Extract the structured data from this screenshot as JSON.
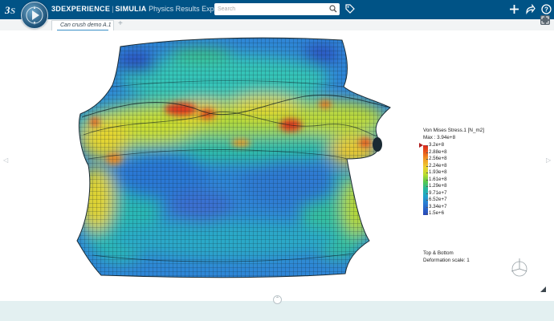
{
  "app": {
    "brand_3d": "3D",
    "brand_experience": "EXPERIENCE",
    "brand_simulia": "SIMULIA",
    "app_name": "Physics Results Explorer",
    "logo_icon": "3ds-logo-icon",
    "compass_icon": "compass-icon"
  },
  "search": {
    "placeholder": "Search",
    "value": ""
  },
  "tabs": [
    {
      "label": "Can crush demo A.1",
      "active": true
    }
  ],
  "tab_add": "+",
  "legend": {
    "title": "Von Mises Stress.1 [N_m2]",
    "max": "Max : 3.94e+8",
    "ticks": [
      "3.2e+8",
      "2.88e+8",
      "2.56e+8",
      "2.24e+8",
      "1.93e+8",
      "1.61e+8",
      "1.29e+8",
      "9.71e+7",
      "6.52e+7",
      "3.34e+7",
      "1.5e+6"
    ],
    "view": "Top & Bottom",
    "deformation": "Deformation scale: 1"
  },
  "colors": {
    "topbar": "#005386",
    "accent": "#3a8fc6",
    "bottom_panel": "#e3f0f1",
    "mesh_blue": "#2a6fd0",
    "mesh_teal": "#22b3b0",
    "mesh_yellow": "#e6d235",
    "mesh_red": "#d8281e"
  },
  "icons": [
    "search-icon",
    "tag-icon",
    "add-icon",
    "share-icon",
    "help-icon",
    "fit-view-icon",
    "axis-triad-icon",
    "collapse-arrow-icon",
    "resize-icon"
  ]
}
